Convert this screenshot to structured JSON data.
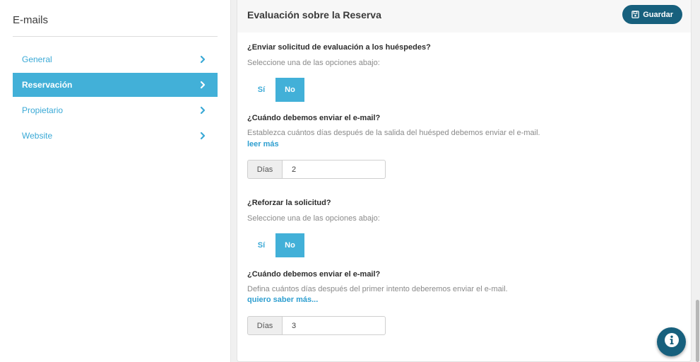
{
  "sidebar": {
    "title": "E-mails",
    "items": [
      {
        "label": "General",
        "active": false
      },
      {
        "label": "Reservación",
        "active": true
      },
      {
        "label": "Propietario",
        "active": false
      },
      {
        "label": "Website",
        "active": false
      }
    ]
  },
  "panel": {
    "title": "Evaluación sobre la Reserva",
    "save_label": "Guardar",
    "sections": {
      "q1": {
        "title": "¿Enviar solicitud de evaluación a los huéspedes?",
        "help": "Seleccione una de las opciones abajo:",
        "yes_label": "Sí",
        "no_label": "No",
        "selected": "No"
      },
      "q2": {
        "title": "¿Cuándo debemos enviar el e-mail?",
        "help": "Establezca cuántos días después de la salida del huésped debemos enviar el e-mail.",
        "link": "leer más",
        "addon": "Días",
        "value": "2"
      },
      "q3": {
        "title": "¿Reforzar la solicitud?",
        "help": "Seleccione una de las opciones abajo:",
        "yes_label": "Sí",
        "no_label": "No",
        "selected": "No"
      },
      "q4": {
        "title": "¿Cuándo debemos enviar el e-mail?",
        "help": "Defina cuántos días después del primer intento deberemos enviar el e-mail.",
        "link": "quiero saber más...",
        "addon": "Días",
        "value": "3"
      }
    }
  },
  "colors": {
    "accent": "#42b0d8",
    "link": "#3aa9d6",
    "primary_button": "#17607d"
  },
  "icons": {
    "save": "floppy-disk-icon",
    "chevron": "chevron-right-icon",
    "info": "info-icon"
  }
}
